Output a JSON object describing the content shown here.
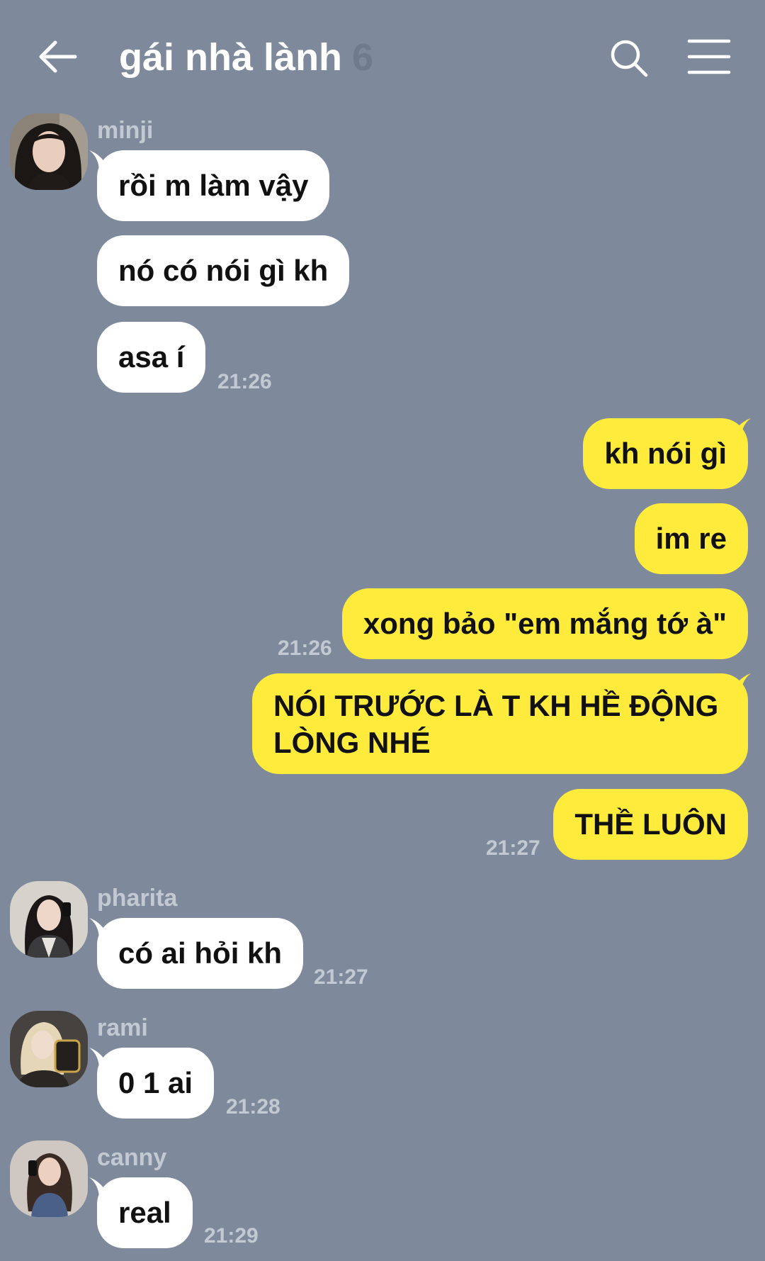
{
  "header": {
    "title": "gái nhà lành",
    "member_count": "6",
    "back_icon": "arrow-left-icon",
    "search_icon": "search-icon",
    "menu_icon": "hamburger-menu-icon"
  },
  "colors": {
    "background": "#7e8a9b",
    "incoming_bubble": "#ffffff",
    "outgoing_bubble": "#ffeb3b",
    "meta_text": "#c2c9d3"
  },
  "messages": {
    "minji": {
      "name": "minji",
      "lines": [
        "rồi m làm vậy",
        "nó có nói gì kh",
        "asa í"
      ],
      "time": "21:26"
    },
    "me1": {
      "lines": [
        "kh nói gì",
        "im re",
        "xong bảo \"em mắng tớ à\""
      ],
      "time": "21:26"
    },
    "me2": {
      "lines": [
        "NÓI TRƯỚC LÀ T KH HỀ ĐỘNG LÒNG NHÉ",
        "THỀ LUÔN"
      ],
      "time": "21:27"
    },
    "pharita": {
      "name": "pharita",
      "lines": [
        "có ai hỏi kh"
      ],
      "time": "21:27"
    },
    "rami": {
      "name": "rami",
      "lines": [
        "0 1 ai"
      ],
      "time": "21:28"
    },
    "canny": {
      "name": "canny",
      "lines": [
        "real"
      ],
      "time": "21:29"
    }
  }
}
